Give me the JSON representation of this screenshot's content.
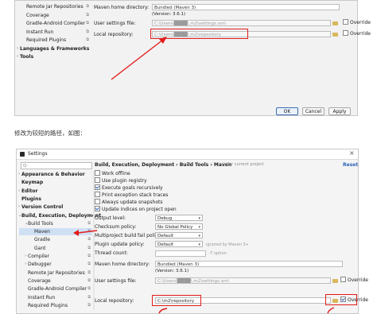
{
  "top_panel": {
    "tree": [
      {
        "label": "Remote Jar Repositories",
        "indent": 1
      },
      {
        "label": "Coverage",
        "indent": 1
      },
      {
        "label": "Gradle-Android Compiler",
        "indent": 1
      },
      {
        "label": "Instant Run",
        "indent": 1
      },
      {
        "label": "Required Plugins",
        "indent": 1
      },
      {
        "label": "Languages & Frameworks",
        "indent": 0,
        "bold": true,
        "arrow": "›"
      },
      {
        "label": "Tools",
        "indent": 0,
        "bold": true,
        "arrow": "›"
      }
    ],
    "maven_home_label": "Maven home directory:",
    "maven_home_value": "Bundled (Maven 3)",
    "version": "(Version: 3.6.1)",
    "settings_label": "User settings file:",
    "settings_value": "C:\\Users\\████\\.m2\\settings.xml",
    "repo_label": "Local repository:",
    "repo_value": "C:\\Users\\████\\.m2\\repository",
    "override_label": "Override",
    "ok": "OK",
    "cancel": "Cancel",
    "apply": "Apply"
  },
  "caption": "修改为较短的路径，如图：",
  "settings": {
    "title": "Settings",
    "search_placeholder": "Q-",
    "breadcrumb": "Build, Execution, Deployment › Build Tools › Maven",
    "for_project": "For current project",
    "reset": "Reset",
    "tree": [
      {
        "label": "Appearance & Behavior",
        "indent": 0,
        "bold": true,
        "arrow": "›"
      },
      {
        "label": "Keymap",
        "indent": 0,
        "bold": true
      },
      {
        "label": "Editor",
        "indent": 0,
        "bold": true,
        "arrow": "›"
      },
      {
        "label": "Plugins",
        "indent": 0,
        "bold": true
      },
      {
        "label": "Version Control",
        "indent": 0,
        "bold": true,
        "arrow": "›"
      },
      {
        "label": "Build, Execution, Deployment",
        "indent": 0,
        "bold": true,
        "arrow": "⌄"
      },
      {
        "label": "Build Tools",
        "indent": 1,
        "arrow": "⌄"
      },
      {
        "label": "Maven",
        "indent": 2,
        "selected": true
      },
      {
        "label": "Gradle",
        "indent": 2
      },
      {
        "label": "Gant",
        "indent": 2
      },
      {
        "label": "Compiler",
        "indent": 1,
        "arrow": "›"
      },
      {
        "label": "Debugger",
        "indent": 1,
        "arrow": "›"
      },
      {
        "label": "Remote Jar Repositories",
        "indent": 1
      },
      {
        "label": "Coverage",
        "indent": 1
      },
      {
        "label": "Gradle-Android Compiler",
        "indent": 1
      },
      {
        "label": "Instant Run",
        "indent": 1
      },
      {
        "label": "Required Plugins",
        "indent": 1
      }
    ],
    "checkboxes": [
      {
        "label": "Work offline",
        "checked": false
      },
      {
        "label": "Use plugin registry",
        "checked": false
      },
      {
        "label": "Execute goals recursively",
        "checked": true
      },
      {
        "label": "Print exception stack traces",
        "checked": false
      },
      {
        "label": "Always update snapshots",
        "checked": false
      },
      {
        "label": "Update indices on project open",
        "checked": true
      }
    ],
    "output_level_label": "Output level:",
    "output_level_value": "Debug",
    "checksum_label": "Checksum policy:",
    "checksum_value": "No Global Policy",
    "multiproject_label": "Multiproject build fail policy:",
    "multiproject_value": "Default",
    "plugin_update_label": "Plugin update policy:",
    "plugin_update_value": "Default",
    "plugin_update_hint": "ignored by Maven 3+",
    "thread_label": "Thread count:",
    "thread_value": "",
    "thread_hint": "-T option",
    "maven_home_label": "Maven home directory:",
    "maven_home_value": "Bundled (Maven 3)",
    "version": "(Version: 3.6.1)",
    "settings_label": "User settings file:",
    "settings_value": "C:\\Users\\████\\.m2\\settings.xml",
    "repo_label": "Local repository:",
    "repo_value": "C:\\m2\\repository",
    "override_label": "Override"
  },
  "colors": {
    "annotation": "#e21b1b",
    "selection": "#cfe0f5",
    "link": "#2a62b8"
  }
}
